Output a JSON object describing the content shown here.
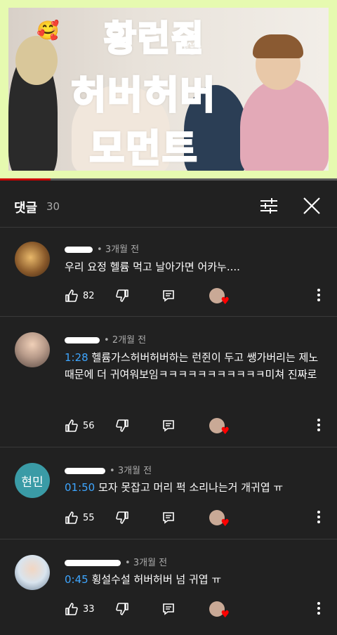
{
  "video": {
    "title_lines": [
      "황런쥔",
      "허버허버",
      "모먼트"
    ],
    "emoji_left": "🥰",
    "emoji_right": "😸",
    "progress_fraction": 0.15,
    "frame_color": "#e6fab0",
    "title_color": "#b6f04a"
  },
  "comments_header": {
    "title": "댓글",
    "count": "30",
    "icons": [
      "sort-icon",
      "close-icon"
    ]
  },
  "comments": [
    {
      "age": "3개월 전",
      "timestamp": "",
      "text": "우리 요정 헬륨 먹고 날아가면 어카누....",
      "likes": "82",
      "avatar_text": "",
      "avatar_color": "#8a5a2b"
    },
    {
      "age": "2개월 전",
      "timestamp": "1:28",
      "text": " 헬륨가스허버허버하는 런쥔이 두고 쌩가버리는 제노때문에 더 귀여워보임ㅋㅋㅋㅋㅋㅋㅋㅋㅋㅋㅋ미쳐 진짜로",
      "likes": "56",
      "avatar_text": "",
      "avatar_color": "#b89b8a"
    },
    {
      "age": "3개월 전",
      "timestamp": "01:50",
      "text": " 모자 못잡고 머리 퍽 소리나는거 개귀엽 ㅠ",
      "likes": "55",
      "avatar_text": "현민",
      "avatar_color": "#3a9ba6"
    },
    {
      "age": "3개월 전",
      "timestamp": "0:45",
      "text": " 횡설수설 허버허버 넘 귀엽 ㅠ",
      "likes": "33",
      "avatar_text": "",
      "avatar_color": "#d9e4ee"
    }
  ]
}
